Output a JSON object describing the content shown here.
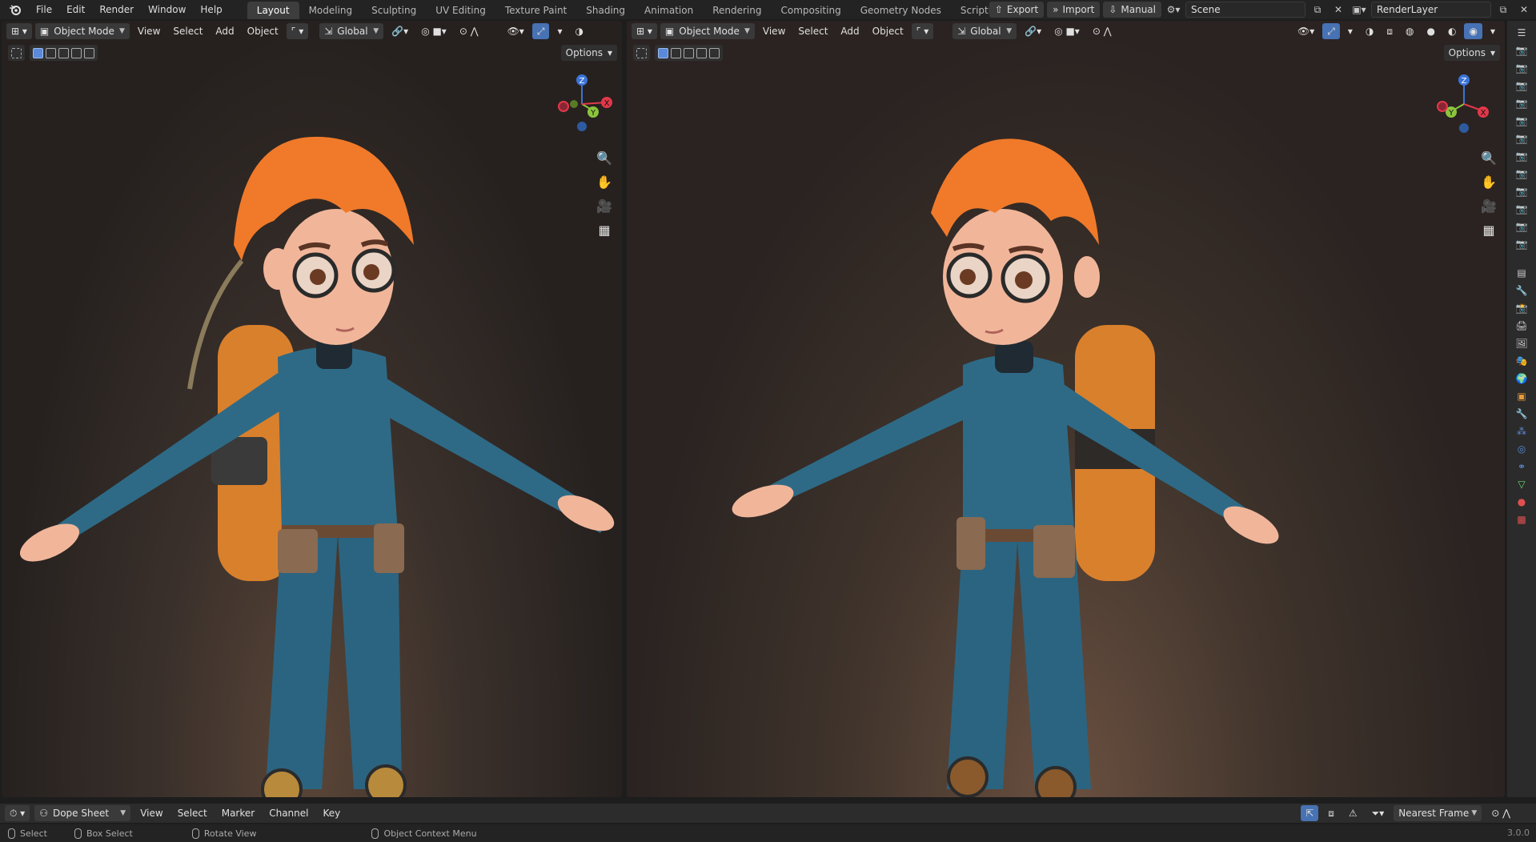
{
  "app": {
    "menu": [
      "File",
      "Edit",
      "Render",
      "Window",
      "Help"
    ],
    "workspaces": [
      "Layout",
      "Modeling",
      "Sculpting",
      "UV Editing",
      "Texture Paint",
      "Shading",
      "Animation",
      "Rendering",
      "Compositing",
      "Geometry Nodes",
      "Scripting"
    ],
    "active_workspace": "Layout",
    "add_workspace": "+",
    "export_label": "Export",
    "import_label": "Import",
    "manual_label": "Manual",
    "scene_name": "Scene",
    "render_layer": "RenderLayer"
  },
  "viewport_left": {
    "mode": "Object Mode",
    "menus": [
      "View",
      "Select",
      "Add",
      "Object"
    ],
    "transform_orientation": "Global",
    "options_label": "Options"
  },
  "viewport_right": {
    "mode": "Object Mode",
    "menus": [
      "View",
      "Select",
      "Add",
      "Object"
    ],
    "transform_orientation": "Global",
    "options_label": "Options"
  },
  "gizmo": {
    "z": "Z",
    "y": "Y",
    "x": "X"
  },
  "dopesheet": {
    "editor": "Dope Sheet",
    "menus": [
      "View",
      "Select",
      "Marker",
      "Channel",
      "Key"
    ],
    "snap": "Nearest Frame"
  },
  "status": {
    "select": "Select",
    "box_select": "Box Select",
    "rotate_view": "Rotate View",
    "context_menu": "Object Context Menu",
    "version": "3.0.0"
  },
  "colors": {
    "accent_blue": "#4772b3",
    "active_tab": "#3d3d3d",
    "hair": "#f07a2a",
    "suit": "#2e6a86",
    "tank": "#d9802d",
    "skin": "#f1b69a"
  },
  "icons": [
    "blender-logo",
    "zoom-icon",
    "hand-pan-icon",
    "camera-icon",
    "grid-icon",
    "render-icon",
    "folder-icon"
  ]
}
